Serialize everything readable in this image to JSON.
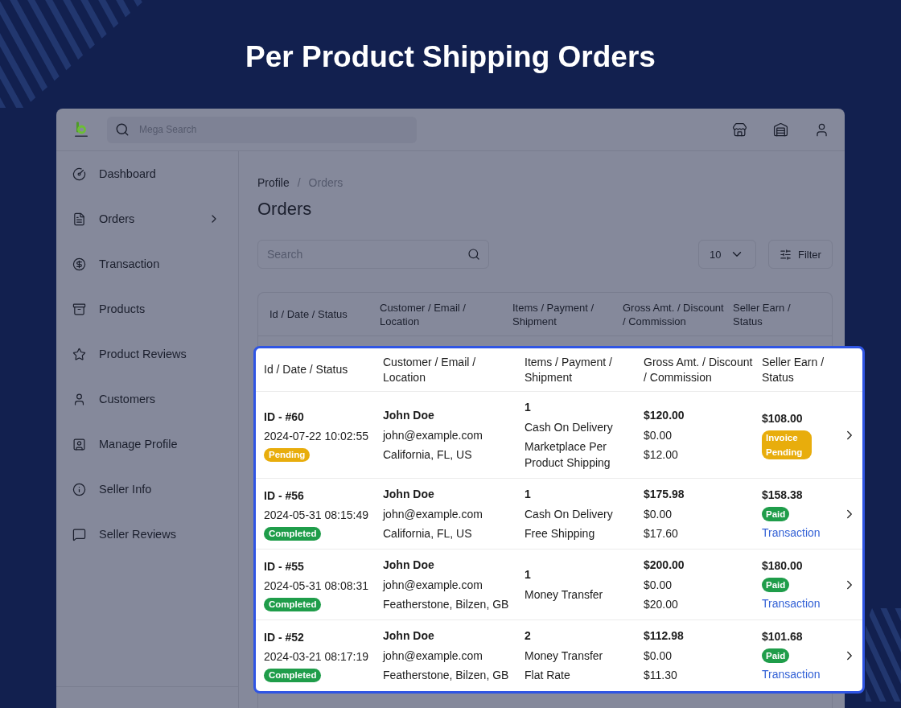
{
  "title": "Per Product Shipping Orders",
  "app": {
    "header": {
      "search": {
        "placeholder": "Mega Search"
      }
    },
    "sidebar": {
      "items": [
        {
          "label": "Dashboard",
          "kind": "link"
        },
        {
          "label": "Orders",
          "kind": "group"
        },
        {
          "label": "Transaction",
          "kind": "link"
        },
        {
          "label": "Products",
          "kind": "link"
        },
        {
          "label": "Product Reviews",
          "kind": "link"
        },
        {
          "label": "Customers",
          "kind": "link"
        },
        {
          "label": "Manage Profile",
          "kind": "link"
        },
        {
          "label": "Seller Info",
          "kind": "link"
        },
        {
          "label": "Seller Reviews",
          "kind": "link"
        }
      ]
    },
    "breadcrumb": {
      "separator": "/",
      "items": [
        {
          "label": "Profile",
          "current": false
        },
        {
          "label": "Orders",
          "current": true
        }
      ]
    },
    "heading": "Orders",
    "toolbar": {
      "search": {
        "placeholder": "Search"
      },
      "page_size": "10",
      "filter_label": "Filter"
    },
    "table": {
      "columns": [
        "Id / Date / Status",
        "Customer / Email / Location",
        "Items / Payment / Shipment",
        "Gross Amt. / Discount / Commission",
        "Seller Earn / Status"
      ]
    }
  },
  "highlight_table": {
    "columns": [
      "Id / Date / Status",
      "Customer / Email / Location",
      "Items / Payment / Shipment",
      "Gross Amt. / Discount / Commission",
      "Seller Earn / Status"
    ],
    "rows": [
      {
        "id": "ID - #60",
        "date": "2024-07-22 10:02:55",
        "status": {
          "label": "Pending",
          "color": "#e8ad0c"
        },
        "customer": "John Doe",
        "email": "john@example.com",
        "location": "California, FL, US",
        "items": "1",
        "payment": "Cash On Delivery",
        "shipment": "Marketplace Per Product Shipping",
        "gross": "$120.00",
        "discount": "$0.00",
        "commission": "$12.00",
        "seller_earn": "$108.00",
        "payment_status": {
          "label": "Invoice Pending",
          "color": "#e8ad0c"
        }
      },
      {
        "id": "ID - #56",
        "date": "2024-05-31 08:15:49",
        "status": {
          "label": "Completed",
          "color": "#1f9d4a"
        },
        "customer": "John Doe",
        "email": "john@example.com",
        "location": "California, FL, US",
        "items": "1",
        "payment": "Cash On Delivery",
        "shipment": "Free Shipping",
        "gross": "$175.98",
        "discount": "$0.00",
        "commission": "$17.60",
        "seller_earn": "$158.38",
        "payment_status": {
          "label": "Paid",
          "color": "#1f9d4a"
        },
        "link": "Transaction"
      },
      {
        "id": "ID - #55",
        "date": "2024-05-31 08:08:31",
        "status": {
          "label": "Completed",
          "color": "#1f9d4a"
        },
        "customer": "John Doe",
        "email": "john@example.com",
        "location": "Featherstone, Bilzen, GB",
        "items": "1",
        "payment": "Money Transfer",
        "gross": "$200.00",
        "discount": "$0.00",
        "commission": "$20.00",
        "seller_earn": "$180.00",
        "payment_status": {
          "label": "Paid",
          "color": "#1f9d4a"
        },
        "link": "Transaction"
      },
      {
        "id": "ID - #52",
        "date": "2024-03-21 08:17:19",
        "status": {
          "label": "Completed",
          "color": "#1f9d4a"
        },
        "customer": "John Doe",
        "email": "john@example.com",
        "location": "Featherstone, Bilzen, GB",
        "items": "2",
        "payment": "Money Transfer",
        "shipment": "Flat Rate",
        "gross": "$112.98",
        "discount": "$0.00",
        "commission": "$11.30",
        "seller_earn": "$101.68",
        "payment_status": {
          "label": "Paid",
          "color": "#1f9d4a"
        },
        "link": "Transaction"
      }
    ]
  }
}
